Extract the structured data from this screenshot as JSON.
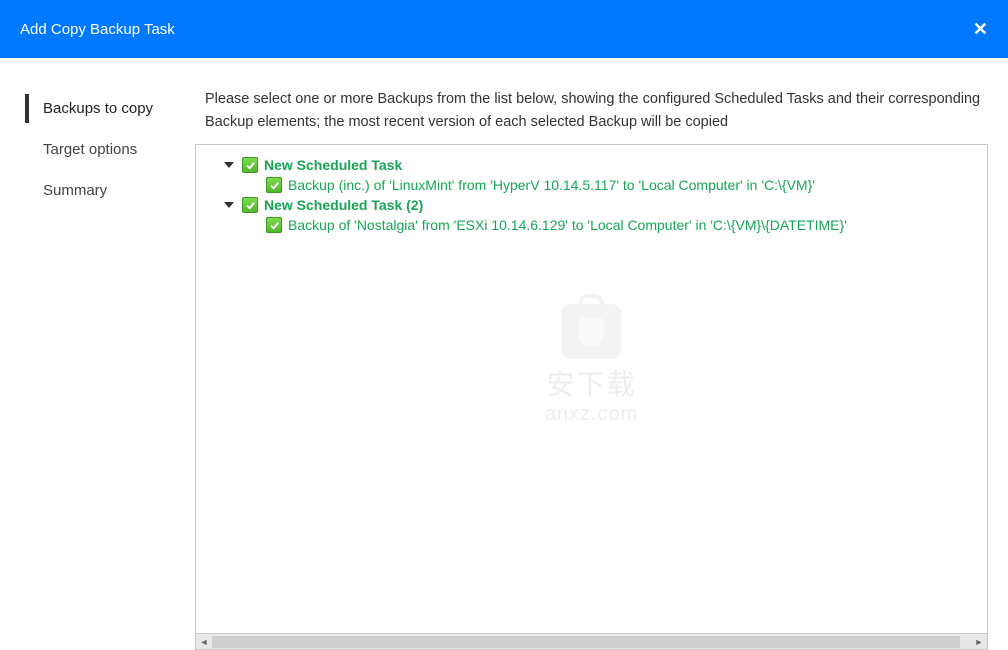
{
  "header": {
    "title": "Add Copy Backup Task"
  },
  "sidebar": {
    "items": [
      {
        "label": "Backups to copy",
        "active": true
      },
      {
        "label": "Target options",
        "active": false
      },
      {
        "label": "Summary",
        "active": false
      }
    ]
  },
  "main": {
    "instruction": "Please select one or more Backups from the list below, showing the configured Scheduled Tasks and their corresponding Backup elements; the most recent version of each selected Backup will be copied",
    "tree": [
      {
        "label": "New Scheduled Task",
        "checked": true,
        "expanded": true,
        "children": [
          {
            "label": "Backup (inc.) of 'LinuxMint' from 'HyperV 10.14.5.117' to 'Local Computer' in 'C:\\{VM}'",
            "checked": true
          }
        ]
      },
      {
        "label": "New Scheduled Task (2)",
        "checked": true,
        "expanded": true,
        "children": [
          {
            "label": "Backup of 'Nostalgia' from 'ESXi 10.14.6.129' to 'Local Computer' in 'C:\\{VM}\\{DATETIME}'",
            "checked": true
          }
        ]
      }
    ]
  },
  "watermark": {
    "cn": "安下载",
    "en": "anxz.com"
  }
}
